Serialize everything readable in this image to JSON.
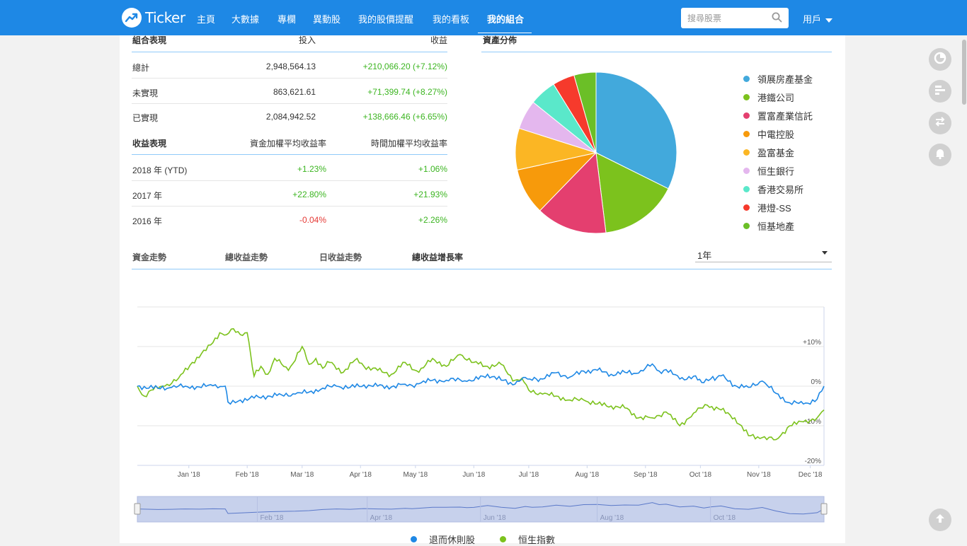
{
  "header": {
    "logo_text": "Ticker",
    "nav": [
      "主頁",
      "大數據",
      "專欄",
      "異動股",
      "我的股價提醒",
      "我的看板",
      "我的組合"
    ],
    "active_nav": "我的組合",
    "search_placeholder": "搜尋股票",
    "user_label": "用戶"
  },
  "portfolio": {
    "headers": [
      "組合表現",
      "投入",
      "收益"
    ],
    "rows": [
      {
        "label": "總計",
        "invest": "2,948,564.13",
        "gain": "+210,066.20 (+7.12%)"
      },
      {
        "label": "未實現",
        "invest": "863,621.61",
        "gain": "+71,399.74 (+8.27%)"
      },
      {
        "label": "已實現",
        "invest": "2,084,942.52",
        "gain": "+138,666.46 (+6.65%)"
      }
    ]
  },
  "returns": {
    "headers": [
      "收益表現",
      "資金加權平均收益率",
      "時間加權平均收益率"
    ],
    "rows": [
      {
        "label": "2018 年 (YTD)",
        "mwr": "+1.23%",
        "twr": "+1.06%",
        "mwr_sign": "pos",
        "twr_sign": "pos"
      },
      {
        "label": "2017 年",
        "mwr": "+22.80%",
        "twr": "+21.93%",
        "mwr_sign": "pos",
        "twr_sign": "pos"
      },
      {
        "label": "2016 年",
        "mwr": "-0.04%",
        "twr": "+2.26%",
        "mwr_sign": "neg",
        "twr_sign": "pos"
      }
    ]
  },
  "allocation": {
    "title": "資產分佈"
  },
  "chart_tabs": [
    "資金走勢",
    "總收益走勢",
    "日收益走勢",
    "總收益增長率"
  ],
  "active_chart_tab": "總收益增長率",
  "range_select": "1年",
  "colors": {
    "brand": "#1e88e5",
    "positive": "#3cb521",
    "negative": "#e53935",
    "series_portfolio": "#1e88e5",
    "series_index": "#7cc21d"
  },
  "side_buttons": [
    "pie-chart-icon",
    "bar-chart-icon",
    "swap-icon",
    "bell-icon"
  ],
  "chart_data": [
    {
      "type": "pie",
      "labels": [
        "領展房產基金",
        "港鐵公司",
        "置富產業信託",
        "中電控股",
        "盈富基金",
        "恒生銀行",
        "香港交易所",
        "港燈-SS",
        "恒基地產"
      ],
      "values": [
        33.0,
        16.0,
        14.5,
        9.5,
        8.5,
        6.0,
        5.5,
        4.5,
        4.5
      ],
      "colors": [
        "#42a9dc",
        "#7cc21d",
        "#e43f6f",
        "#f79a0b",
        "#fbb624",
        "#e4b7ee",
        "#5ae8ca",
        "#f63a2c",
        "#6bbf27"
      ]
    },
    {
      "type": "line",
      "x_ticks": [
        "Jan '18",
        "Feb '18",
        "Mar '18",
        "Apr '18",
        "May '18",
        "Jun '18",
        "Jul '18",
        "Aug '18",
        "Sep '18",
        "Oct '18",
        "Nov '18",
        "Dec '18"
      ],
      "y_ticks": [
        "+10%",
        "0%",
        "-10%",
        "-20%"
      ],
      "ylim": [
        -20,
        20
      ],
      "series": [
        {
          "name": "退而休則股",
          "color": "#1e88e5",
          "x": [
            0,
            3,
            5,
            7,
            9,
            11,
            12.8,
            13.2,
            15,
            17,
            19,
            21,
            23,
            25,
            27,
            29,
            31,
            33,
            35,
            37,
            39,
            40,
            41,
            43,
            45,
            47,
            48,
            49,
            51,
            53,
            55,
            56.5,
            57.5,
            59,
            61,
            63,
            65,
            67,
            69,
            71,
            73,
            75,
            76,
            77,
            79,
            81,
            82.5,
            83.5,
            85,
            87,
            89,
            91,
            93,
            95,
            97,
            99,
            100
          ],
          "y": [
            0,
            -0.5,
            -0.3,
            0,
            -0.2,
            0.1,
            0,
            -4,
            -3.5,
            -3,
            -2.5,
            -2.2,
            -2,
            -1.5,
            -0.5,
            0,
            -0.3,
            0.3,
            0,
            -0.2,
            0.5,
            0.2,
            0.6,
            1.5,
            1.5,
            1.6,
            1.2,
            1.4,
            3,
            1.5,
            0.5,
            2.2,
            1.5,
            1.8,
            3.4,
            2.3,
            3.8,
            4,
            3,
            3.5,
            3.3,
            5.6,
            3.8,
            4.2,
            1.8,
            2.5,
            0.9,
            1.8,
            2.6,
            0.2,
            -0.3,
            1.3,
            -1.8,
            -4.2,
            -4.5,
            -3.3,
            0
          ]
        },
        {
          "name": "恒生指數",
          "color": "#7cc21d",
          "x": [
            0,
            1,
            2,
            4,
            6,
            8,
            10,
            12,
            13,
            14,
            15,
            16,
            16.5,
            17,
            18,
            19,
            20,
            22,
            24,
            25,
            26,
            27,
            28,
            30,
            32,
            33,
            35,
            37,
            39,
            41,
            43,
            45,
            47,
            49,
            51,
            53,
            54,
            55,
            56,
            57,
            59,
            61,
            63,
            65,
            67,
            69,
            71,
            73,
            75,
            77,
            79,
            81,
            82,
            83,
            85,
            87,
            89,
            91,
            93,
            95,
            97,
            99,
            100
          ],
          "y": [
            0,
            -2.5,
            -1,
            0,
            2,
            6,
            9,
            13.5,
            13,
            14.5,
            13,
            13.5,
            8,
            2.5,
            5,
            3,
            7,
            4,
            10,
            5.5,
            7,
            4.5,
            6,
            3.5,
            7,
            5,
            4,
            3,
            6,
            3.5,
            7,
            5,
            8,
            6,
            5,
            5.5,
            3,
            1.5,
            2,
            -1,
            -2,
            -2.5,
            -3.5,
            -3.5,
            -4.5,
            -5,
            -5.5,
            -8,
            -8,
            -6.5,
            -10,
            -6.8,
            -5.5,
            -4.8,
            -6,
            -8,
            -12.5,
            -13,
            -13.5,
            -10,
            -9,
            -8,
            -6
          ]
        }
      ],
      "navigator_ticks": [
        "Feb '18",
        "Apr '18",
        "Jun '18",
        "Aug '18",
        "Oct '18"
      ]
    }
  ]
}
